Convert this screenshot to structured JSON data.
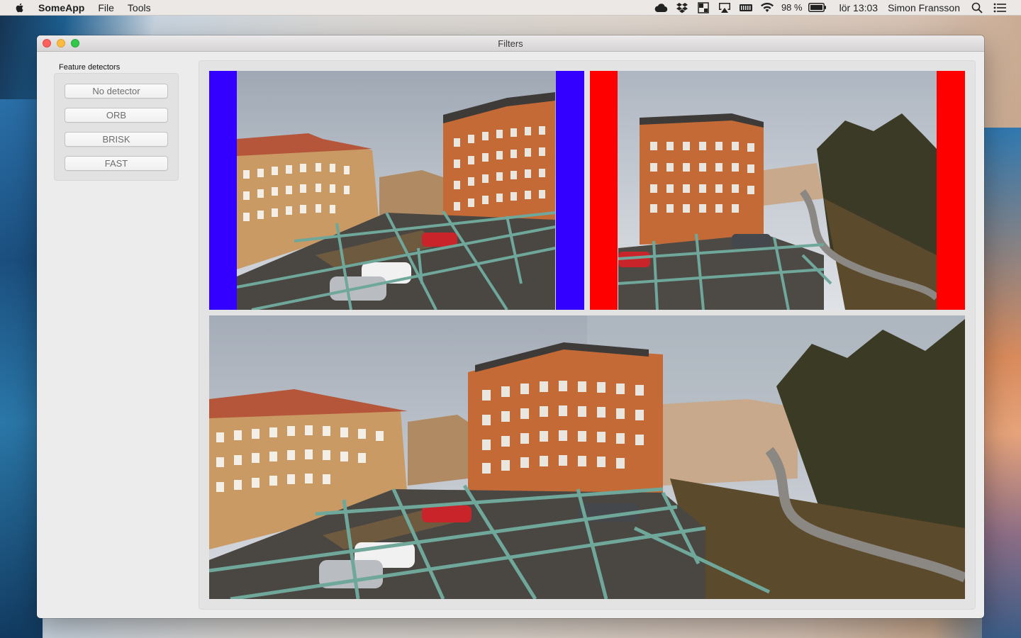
{
  "menubar": {
    "app_name": "SomeApp",
    "items": [
      "File",
      "Tools"
    ],
    "battery_percent": "98 %",
    "clock": "lör 13:03",
    "user": "Simon Fransson",
    "status_icons": [
      "creative-cloud-icon",
      "dropbox-icon",
      "window-manager-icon",
      "airplay-icon",
      "memory-icon",
      "wifi-icon",
      "battery-icon",
      "spotlight-search-icon",
      "notification-center-icon"
    ]
  },
  "window": {
    "title": "Filters"
  },
  "sidebar": {
    "group_label": "Feature detectors",
    "buttons": [
      {
        "label": "No detector"
      },
      {
        "label": "ORB"
      },
      {
        "label": "BRISK"
      },
      {
        "label": "FAST"
      }
    ]
  },
  "images": {
    "left_border_color": "#3300ff",
    "right_border_color": "#ff0000"
  }
}
